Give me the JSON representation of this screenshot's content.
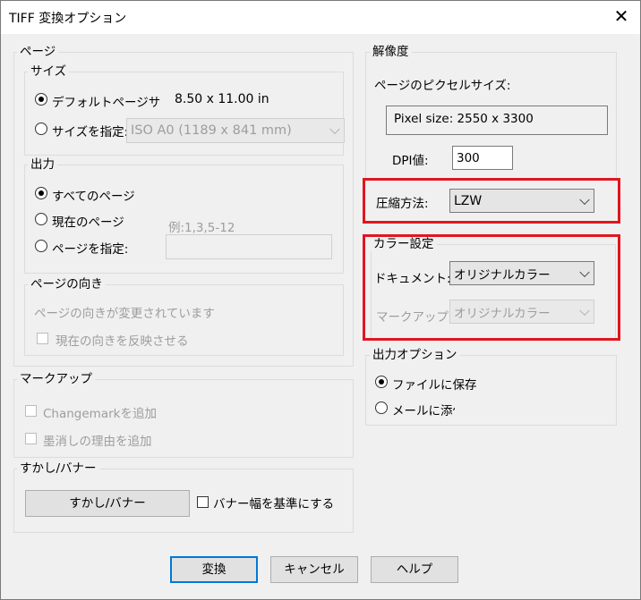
{
  "window": {
    "title": "TIFF 変換オプション",
    "close": "✕"
  },
  "page": {
    "label": "ページ",
    "size": {
      "label": "サイズ",
      "default_option": "デフォルトページサイズ",
      "default_value": "8.50 x 11.00 in",
      "specify_option": "サイズを指定:",
      "specify_combo": "ISO A0 (1189 x 841 mm)"
    },
    "output": {
      "label": "出力",
      "all_pages": "すべてのページ",
      "current_page": "現在のページ",
      "specify_pages": "ページを指定:",
      "pages_hint": "例:1,3,5-12",
      "pages_value": ""
    },
    "orientation": {
      "label": "ページの向き",
      "status": "ページの向きが変更されています",
      "reflect": "現在の向きを反映させる"
    }
  },
  "markup": {
    "label": "マークアップ",
    "changemark": "Changemarkを追加",
    "strike_reason": "墨消しの理由を追加"
  },
  "watermark": {
    "label": "すかし/バナー",
    "button": "すかし/バナー",
    "banner_width": "バナー幅を基準にする"
  },
  "resolution": {
    "label": "解像度",
    "pixel_size_label": "ページのピクセルサイズ:",
    "pixel_size_value": "Pixel size: 2550 x 3300",
    "dpi_label": "DPI値:",
    "dpi_value": "300"
  },
  "compression": {
    "label": "圧縮方法:",
    "value": "LZW"
  },
  "color": {
    "label": "カラー設定",
    "document_label": "ドキュメント:",
    "document_value": "オリジナルカラー",
    "markup_label": "マークアップ:",
    "markup_value": "オリジナルカラー"
  },
  "output_options": {
    "label": "出力オプション",
    "save_file": "ファイルに保存",
    "attach_mail": "メールに添付"
  },
  "buttons": {
    "convert": "変換",
    "cancel": "キャンセル",
    "help": "ヘルプ"
  },
  "colors": {
    "highlight": "#e0161f",
    "default_button_border": "#0078d7"
  }
}
